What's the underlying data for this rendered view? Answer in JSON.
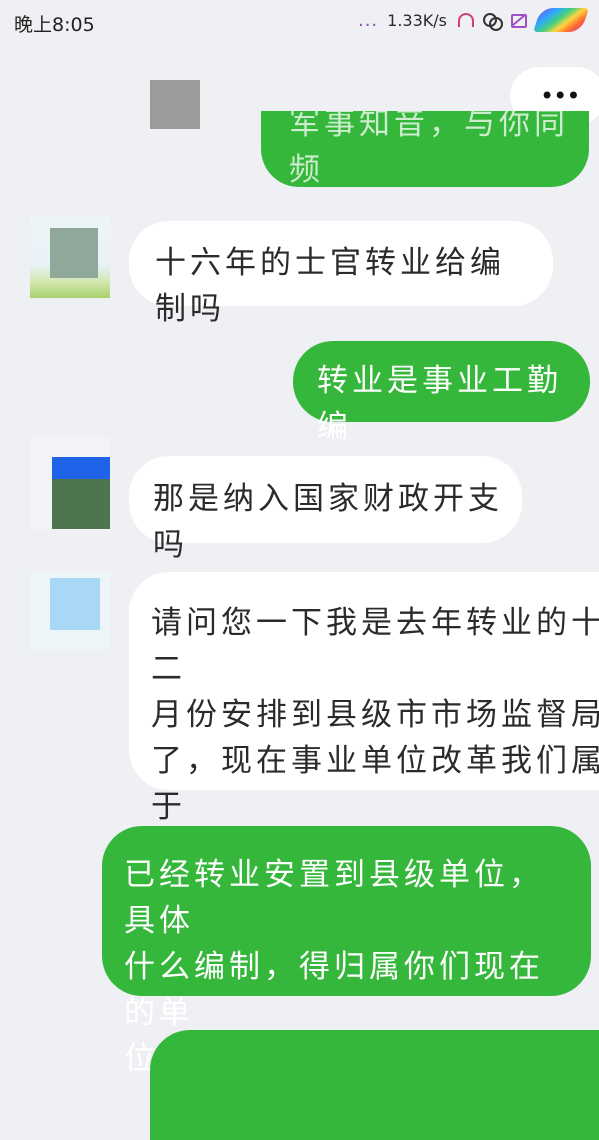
{
  "status_bar": {
    "time": "晚上8:05",
    "dots": "...",
    "net_speed": "1.33K/s",
    "icons": [
      "headphone-icon",
      "circles-icon",
      "tag-icon",
      "rainbow-app-icon"
    ]
  },
  "menu": {
    "label": "•••"
  },
  "messages": [
    {
      "id": "top-partial",
      "side": "sent",
      "text": "军事知音，与你同频"
    },
    {
      "id": "m2",
      "side": "received",
      "text": "十六年的士官转业给编制吗"
    },
    {
      "id": "m3",
      "side": "sent",
      "text": "转业是事业工勤编"
    },
    {
      "id": "m4",
      "side": "received",
      "text": "那是纳入国家财政开支吗"
    },
    {
      "id": "m5",
      "side": "received",
      "text": "请问您一下我是去年转业的十二\n月份安排到县级市市场监督局\n了，现在事业单位改革我们属于\n什么编制啊谢谢"
    },
    {
      "id": "m6",
      "side": "sent",
      "text": "已经转业安置到县级单位，具体\n什么编制，得归属你们现在的单\n位"
    },
    {
      "id": "m7",
      "side": "sent",
      "text": ""
    }
  ],
  "colors": {
    "background": "#eef0f3",
    "sent_bubble": "#35b73b",
    "received_bubble": "#ffffff",
    "received_text": "#2b2b2b",
    "sent_text": "#ffffff"
  }
}
